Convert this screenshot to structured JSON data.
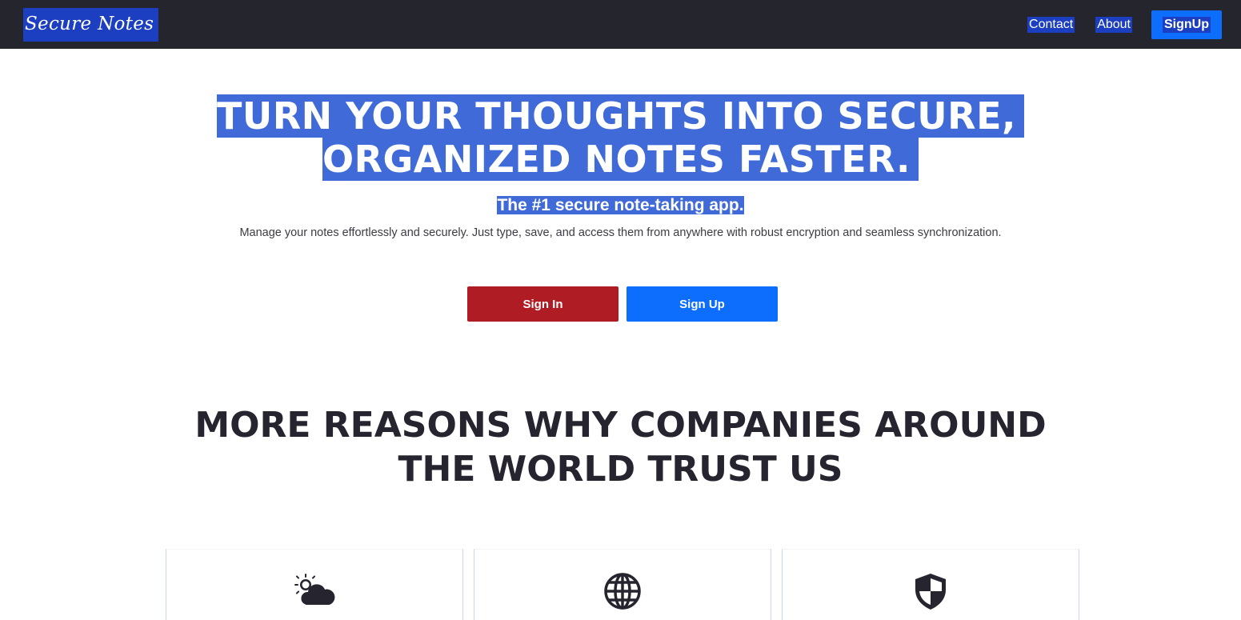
{
  "nav": {
    "brand": "Secure Notes",
    "links": [
      "Contact",
      "About"
    ],
    "signup_label": "SignUp"
  },
  "hero": {
    "title_line1": "TURN YOUR THOUGHTS INTO SECURE,",
    "title_line2": "ORGANIZED NOTES FASTER.",
    "tagline": "The #1 secure note-taking app.",
    "description": "Manage your notes effortlessly and securely. Just type, save, and access them from anywhere with robust encryption and seamless synchronization.",
    "signin_label": "Sign In",
    "signup_label": "Sign Up"
  },
  "reasons": {
    "title_line1": "MORE REASONS WHY COMPANIES AROUND",
    "title_line2": "THE WORLD TRUST US"
  },
  "features": [
    {
      "icon": "cloud-sun-icon"
    },
    {
      "icon": "globe-icon"
    },
    {
      "icon": "shield-icon"
    }
  ],
  "colors": {
    "navbar": "#25252d",
    "selection_highlight": "#3f6ad8",
    "primary_blue": "#0d6efd",
    "signin_red": "#b01c24"
  }
}
